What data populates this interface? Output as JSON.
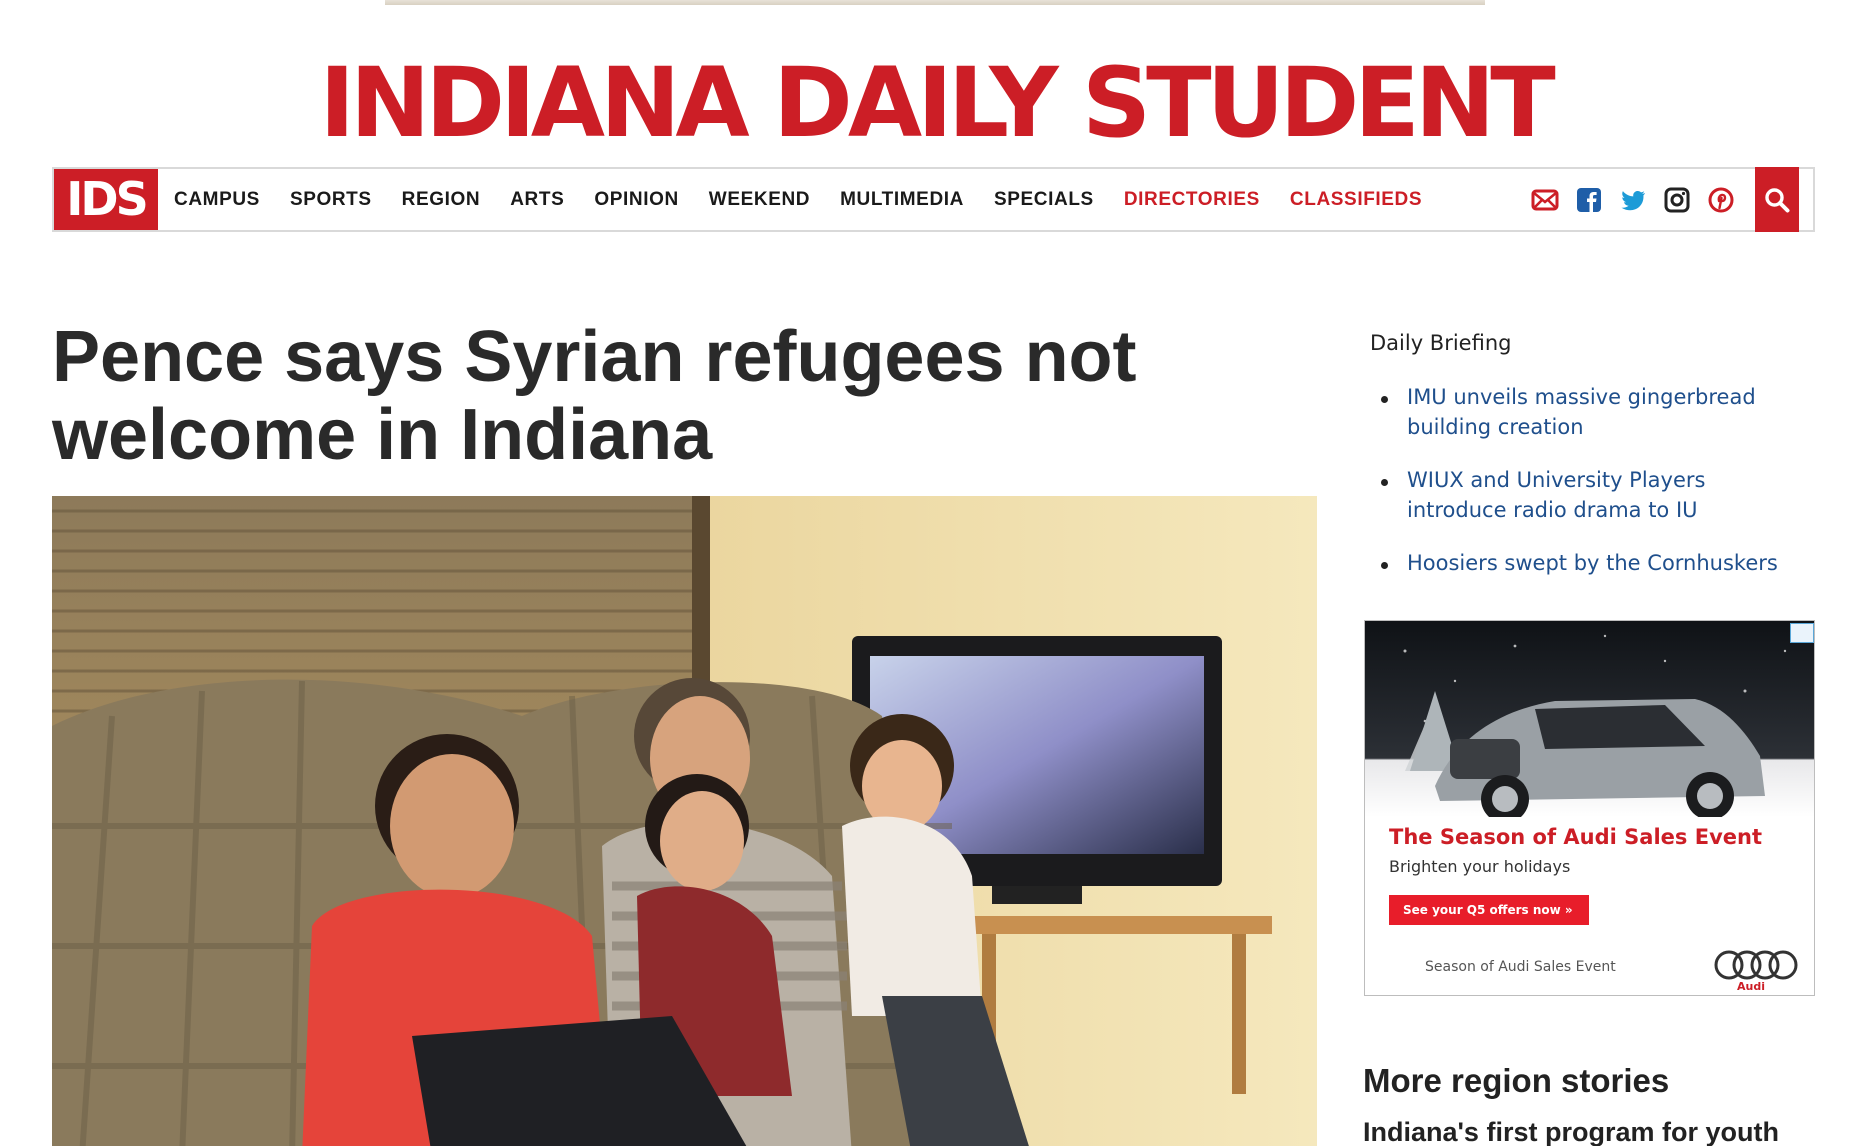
{
  "masthead": {
    "title": "INDIANA DAILY STUDENT"
  },
  "nav": {
    "logo": "IDS",
    "items": [
      {
        "label": "CAMPUS"
      },
      {
        "label": "SPORTS"
      },
      {
        "label": "REGION"
      },
      {
        "label": "ARTS"
      },
      {
        "label": "OPINION"
      },
      {
        "label": "WEEKEND"
      },
      {
        "label": "MULTIMEDIA"
      },
      {
        "label": "SPECIALS"
      },
      {
        "label": "DIRECTORIES"
      },
      {
        "label": "CLASSIFIEDS"
      }
    ],
    "social_icons": [
      "email-icon",
      "facebook-icon",
      "twitter-icon",
      "instagram-icon",
      "pinterest-icon"
    ],
    "search_icon": "search-icon"
  },
  "article": {
    "headline": "Pence says Syrian refugees not welcome in Indiana"
  },
  "sidebar": {
    "briefing_title": "Daily Briefing",
    "briefing_items": [
      {
        "label": "IMU unveils massive gingerbread building creation"
      },
      {
        "label": "WIUX and University Players introduce radio drama to IU"
      },
      {
        "label": "Hoosiers swept by the Cornhuskers"
      }
    ],
    "ad": {
      "headline": "The Season of Audi Sales Event",
      "subline": "Brighten your holidays",
      "cta": "See your Q5 offers now  »",
      "footer": "Season of Audi Sales Event",
      "brand": "Audi"
    },
    "more_title": "More region stories",
    "more_first_story": "Indiana's first program for youth"
  },
  "colors": {
    "brand_red": "#cc1e26",
    "link_blue": "#1f4f8c",
    "text": "#222222"
  }
}
